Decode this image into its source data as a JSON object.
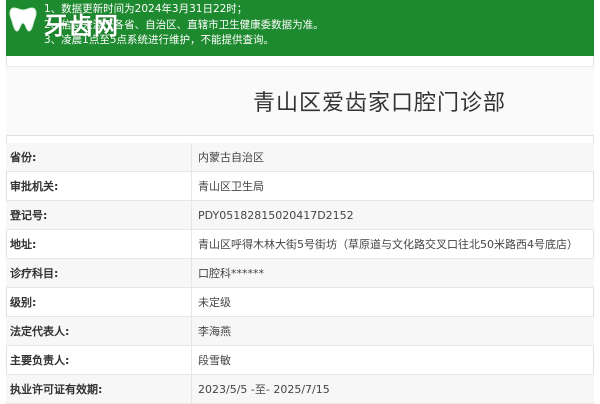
{
  "notice": {
    "lines": [
      "1、数据更新时间为2024年3月31日22时；",
      "2、信息来源于各省、自治区、直辖市卫生健康委数据为准。",
      "3、凌晨1点至5点系统进行维护，不能提供查询。"
    ],
    "background": "#1e8a2f"
  },
  "logo": {
    "brand": "牙齿网",
    "icon": "tooth-icon"
  },
  "clinic": {
    "title": "青山区爱齿家口腔门诊部"
  },
  "rows": [
    {
      "label": "省份:",
      "value": "内蒙古自治区"
    },
    {
      "label": "审批机关:",
      "value": "青山区卫生局"
    },
    {
      "label": "登记号:",
      "value": "PDY05182815020417D2152"
    },
    {
      "label": "地址:",
      "value": "青山区呼得木林大街5号街坊（草原道与文化路交叉口往北50米路西4号底店）"
    },
    {
      "label": "诊疗科目:",
      "value": "口腔科******"
    },
    {
      "label": "级别:",
      "value": "未定级"
    },
    {
      "label": "法定代表人:",
      "value": "李海燕"
    },
    {
      "label": "主要负责人:",
      "value": "段雪敏"
    },
    {
      "label": "执业许可证有效期:",
      "value": "2023/5/5 -至- 2025/7/15"
    }
  ]
}
